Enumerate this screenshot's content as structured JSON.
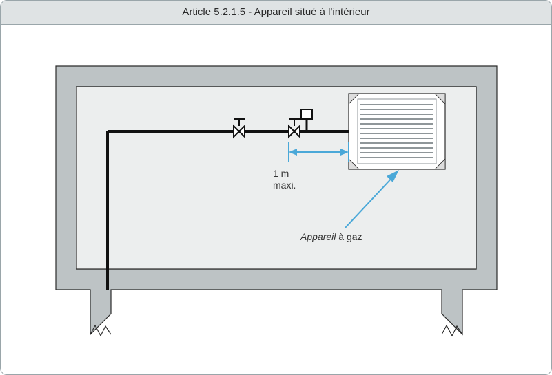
{
  "title": "Article 5.2.1.5  - Appareil situé à l'intérieur",
  "dimension": {
    "label_line1": "1 m",
    "label_line2": "maxi."
  },
  "appliance": {
    "label_prefix_italic": "Appareil",
    "label_rest": " à gaz"
  },
  "colors": {
    "accent": "#4aa8d8",
    "wall": "#bdc3c5",
    "inner_bg": "#eceeee",
    "stroke_dark": "#2b2b2b"
  }
}
